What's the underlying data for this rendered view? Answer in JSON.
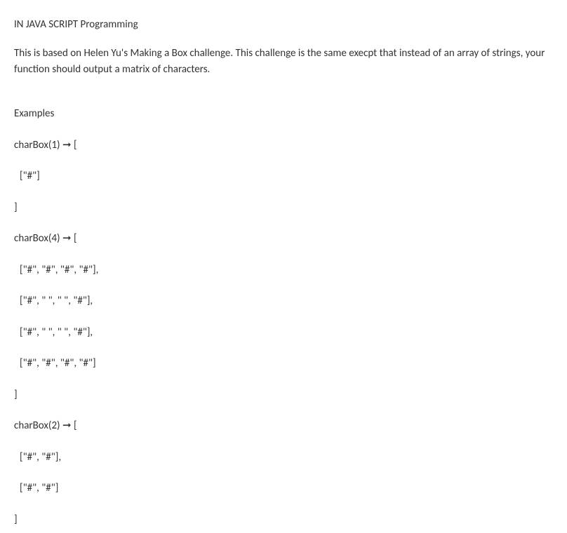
{
  "title": "IN JAVA SCRIPT Programming",
  "description": "This is based on Helen Yu's Making a Box challenge. This challenge is the same execpt that instead of an array of strings, your function should output a matrix of characters.",
  "examplesHeading": "Examples",
  "lines": {
    "ex1_call": "charBox(1) ➞ [",
    "ex1_row1": "[\"#\"]",
    "ex1_close": "]",
    "ex2_call": "charBox(4) ➞ [",
    "ex2_row1": "[\"#\", \"#\", \"#\", \"#\"],",
    "ex2_row2": "[\"#\", \" \", \" \", \"#\"],",
    "ex2_row3": "[\"#\", \" \", \" \", \"#\"],",
    "ex2_row4": "[\"#\", \"#\", \"#\", \"#\"]",
    "ex2_close": "]",
    "ex3_call": "charBox(2) ➞ [",
    "ex3_row1": "[\"#\", \"#\"],",
    "ex3_row2": "[\"#\", \"#\"]",
    "ex3_close": "]"
  }
}
